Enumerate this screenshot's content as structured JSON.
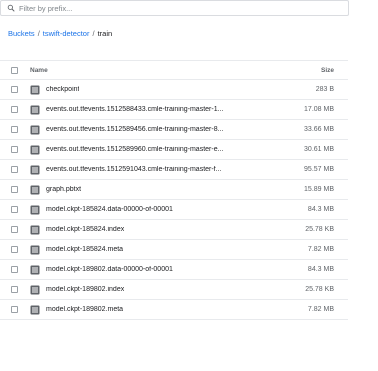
{
  "filter": {
    "placeholder": "Filter by prefix..."
  },
  "breadcrumb": [
    {
      "label": "Buckets"
    },
    {
      "label": "tswift-detector"
    },
    {
      "label": "train"
    }
  ],
  "breadcrumb_separator": "/",
  "table": {
    "headers": {
      "name": "Name",
      "size": "Size"
    },
    "rows": [
      {
        "name": "checkpoint",
        "size": "283 B"
      },
      {
        "name": "events.out.tfevents.1512588433.cmle-training-master-1...",
        "size": "17.08 MB"
      },
      {
        "name": "events.out.tfevents.1512589456.cmle-training-master-8...",
        "size": "33.66 MB"
      },
      {
        "name": "events.out.tfevents.1512589960.cmle-training-master-e...",
        "size": "30.61 MB"
      },
      {
        "name": "events.out.tfevents.1512591043.cmle-training-master-f...",
        "size": "95.57 MB"
      },
      {
        "name": "graph.pbtxt",
        "size": "15.89 MB"
      },
      {
        "name": "model.ckpt-185824.data-00000-of-00001",
        "size": "84.3 MB"
      },
      {
        "name": "model.ckpt-185824.index",
        "size": "25.78 KB"
      },
      {
        "name": "model.ckpt-185824.meta",
        "size": "7.82 MB"
      },
      {
        "name": "model.ckpt-189802.data-00000-of-00001",
        "size": "84.3 MB"
      },
      {
        "name": "model.ckpt-189802.index",
        "size": "25.78 KB"
      },
      {
        "name": "model.ckpt-189802.meta",
        "size": "7.82 MB"
      }
    ]
  },
  "icons": {
    "search": "search-icon",
    "file": "file-icon"
  },
  "colors": {
    "link": "#1a73e8",
    "icon": "#5f6368",
    "border": "#dadce0",
    "text": "#202124"
  }
}
